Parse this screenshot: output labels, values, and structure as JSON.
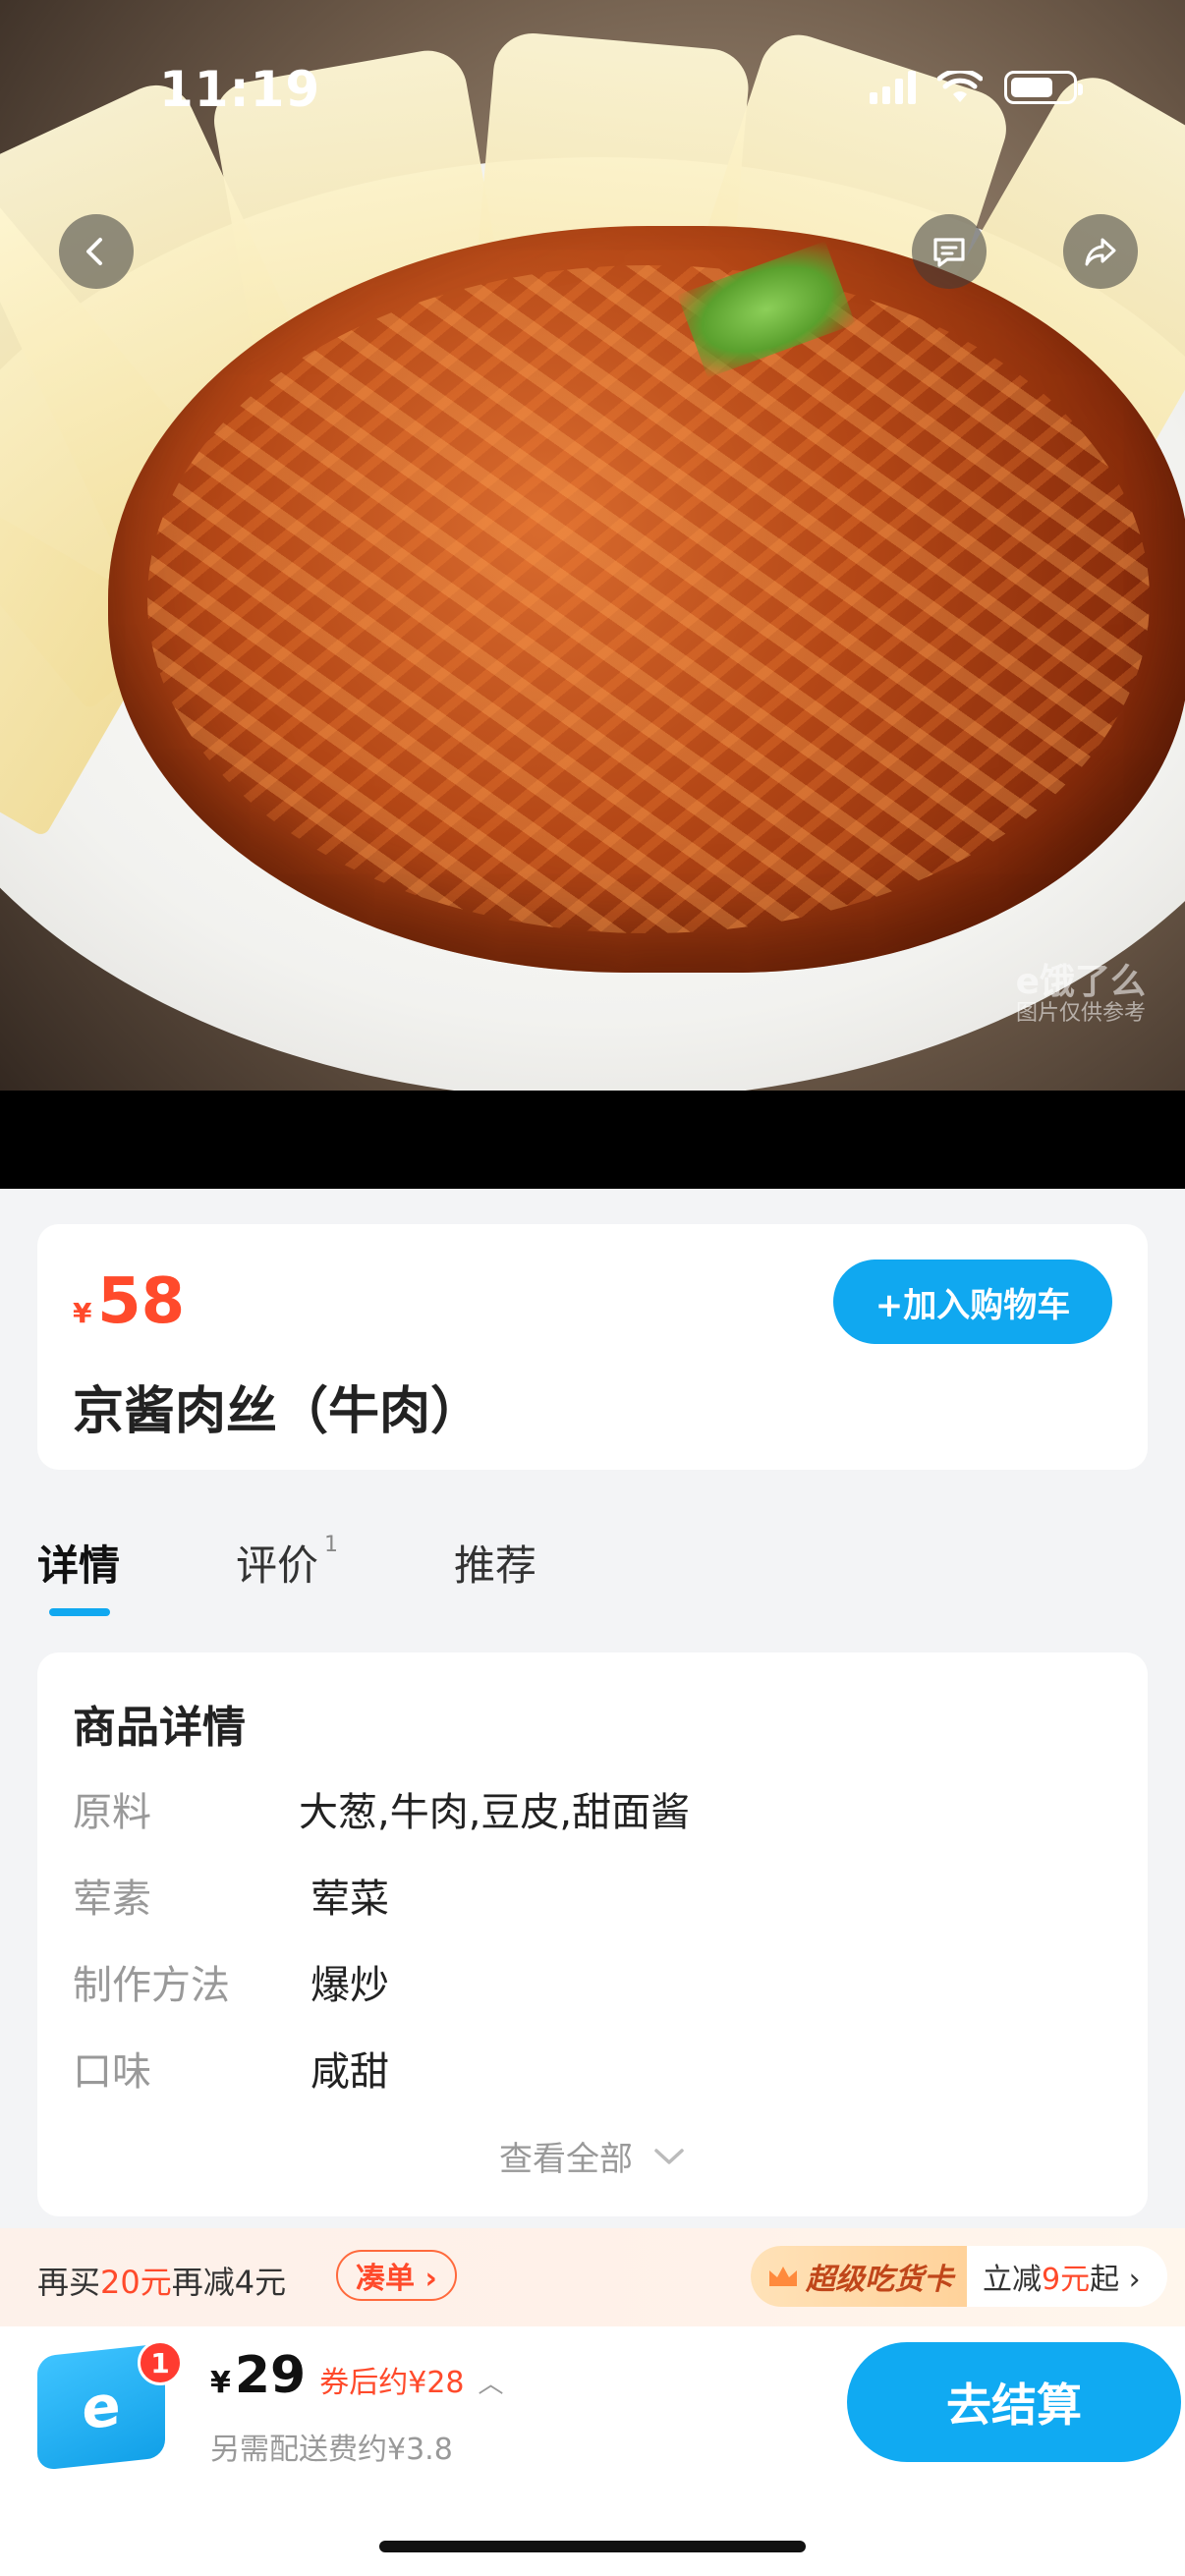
{
  "status_bar": {
    "time": "11:19",
    "battery_percent": 70
  },
  "hero": {
    "watermark_brand": "e饿了么",
    "watermark_note": "图片仅供参考"
  },
  "header_buttons": {
    "back_icon": "chevron-left-icon",
    "message_icon": "message-icon",
    "share_icon": "share-icon"
  },
  "product": {
    "currency": "¥",
    "price": "58",
    "add_to_cart_label": "+加入购物车",
    "name": "京酱肉丝（牛肉）"
  },
  "tabs": [
    {
      "label": "详情",
      "active": true,
      "count": ""
    },
    {
      "label": "评价",
      "active": false,
      "count": "1"
    },
    {
      "label": "推荐",
      "active": false,
      "count": ""
    }
  ],
  "details": {
    "title": "商品详情",
    "rows": [
      {
        "key": "原料",
        "value": "大葱,牛肉,豆皮,甜面酱"
      },
      {
        "key": "荤素",
        "value": "荤菜"
      },
      {
        "key": "制作方法",
        "value": "爆炒"
      },
      {
        "key": "口味",
        "value": "咸甜"
      }
    ],
    "see_all_label": "查看全部"
  },
  "promo": {
    "prefix": "再买",
    "amount": "20元",
    "middle": "再减",
    "discount": "4元",
    "coudan_label": "凑单 ›",
    "vip_badge": "超级吃货卡",
    "vip_prefix": "立减",
    "vip_amount": "9元",
    "vip_suffix": "起 ›"
  },
  "bottom_bar": {
    "cart_count": "1",
    "currency": "¥",
    "total": "29",
    "after_coupon": "券后约¥28",
    "delivery_fee": "另需配送费约¥3.8",
    "checkout_label": "去结算"
  },
  "colors": {
    "accent": "#10a8f0",
    "price": "#ff4a2b",
    "badge": "#ff3b30"
  }
}
